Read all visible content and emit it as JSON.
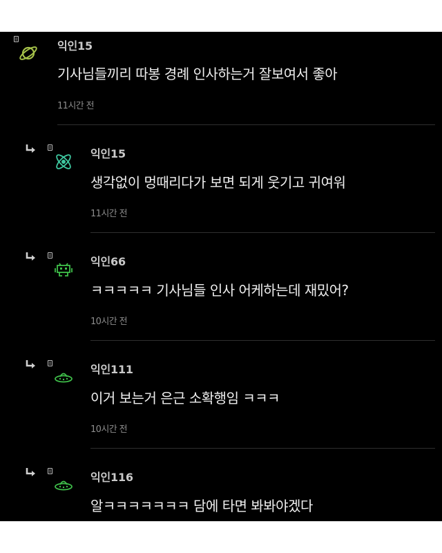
{
  "comments": [
    {
      "author": "익인15",
      "text": "기사님들끼리 따봉 경례 인사하는거 잘보여서 좋아",
      "time": "11시간 전",
      "is_reply": false,
      "avatar_icon": "planet-icon",
      "avatar_color": "#a6c24a"
    },
    {
      "author": "익인15",
      "text": "생각없이 멍때리다가 보면 되게 웃기고 귀여워",
      "time": "11시간 전",
      "is_reply": true,
      "avatar_icon": "atom-icon",
      "avatar_color": "#3ec8a0"
    },
    {
      "author": "익인66",
      "text": "ㅋㅋㅋㅋㅋ 기사님들 인사 어케하는데 재밌어?",
      "time": "10시간 전",
      "is_reply": true,
      "avatar_icon": "space-invader-icon",
      "avatar_color": "#3fbf4a"
    },
    {
      "author": "익인111",
      "text": "이거 보는거 은근 소확행임 ㅋㅋㅋ",
      "time": "10시간 전",
      "is_reply": true,
      "avatar_icon": "ufo-icon",
      "avatar_color": "#3fbf4a"
    },
    {
      "author": "익인116",
      "text": "알ㅋㅋㅋㅋㅋㅋㅋ 담에 타면 봐봐야겠다",
      "time": "",
      "is_reply": true,
      "avatar_icon": "ufo-icon",
      "avatar_color": "#3fbf4a"
    }
  ]
}
